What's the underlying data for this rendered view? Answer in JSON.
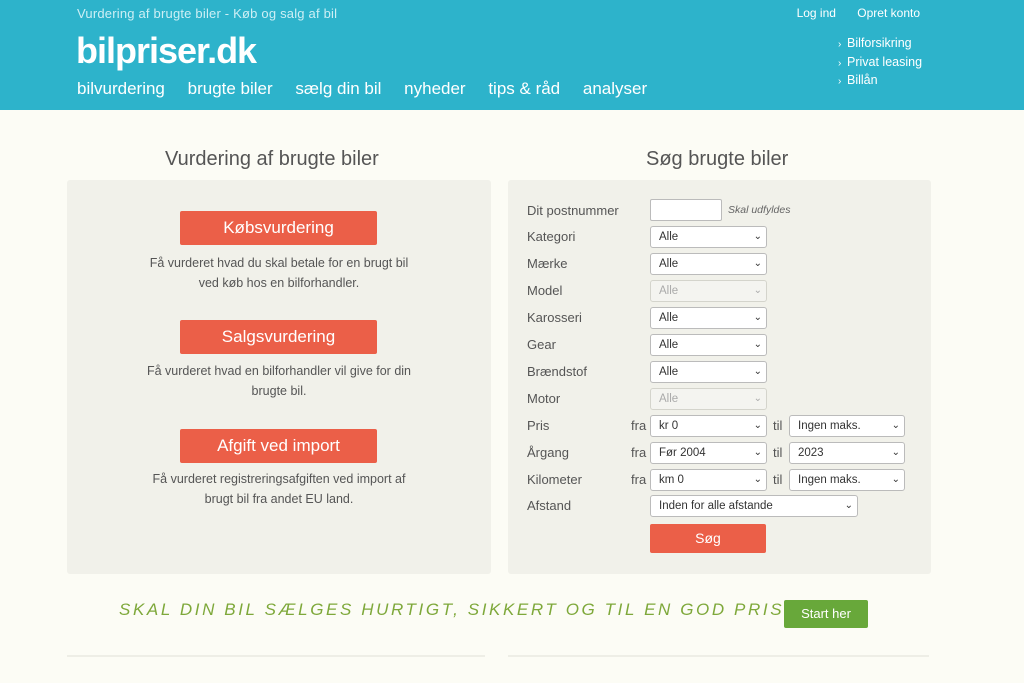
{
  "header": {
    "tagline": "Vurdering af brugte biler - Køb og salg af bil",
    "logo": "bilpriser.dk",
    "top_links": [
      "Log ind",
      "Opret konto"
    ],
    "side_links": [
      "Bilforsikring",
      "Privat leasing",
      "Billån"
    ],
    "nav": [
      "bilvurdering",
      "brugte biler",
      "sælg din bil",
      "nyheder",
      "tips & råd",
      "analyser"
    ]
  },
  "left": {
    "title": "Vurdering af brugte biler",
    "items": [
      {
        "button": "Købsvurdering",
        "desc1": "Få vurderet hvad du skal betale for en brugt bil",
        "desc2": "ved køb hos en bilforhandler."
      },
      {
        "button": "Salgsvurdering",
        "desc1": "Få vurderet hvad en bilforhandler vil give for din",
        "desc2": "brugte bil."
      },
      {
        "button": "Afgift ved import",
        "desc1": "Få vurderet registreringsafgiften ved import af",
        "desc2": "brugt bil fra andet EU land."
      }
    ]
  },
  "search": {
    "title": "Søg brugte biler",
    "postnummer_label": "Dit postnummer",
    "postnummer_value": "",
    "postnummer_hint": "Skal udfyldes",
    "kategori_label": "Kategori",
    "kategori_value": "Alle",
    "maerke_label": "Mærke",
    "maerke_value": "Alle",
    "model_label": "Model",
    "model_value": "Alle",
    "karosseri_label": "Karosseri",
    "karosseri_value": "Alle",
    "gear_label": "Gear",
    "gear_value": "Alle",
    "braendstof_label": "Brændstof",
    "braendstof_value": "Alle",
    "motor_label": "Motor",
    "motor_value": "Alle",
    "pris_label": "Pris",
    "pris_from": "kr 0",
    "pris_to": "Ingen maks.",
    "argang_label": "Årgang",
    "argang_from": "Før 2004",
    "argang_to": "2023",
    "km_label": "Kilometer",
    "km_from": "km 0",
    "km_to": "Ingen maks.",
    "afstand_label": "Afstand",
    "afstand_value": "Inden for alle afstande",
    "fra": "fra",
    "til": "til",
    "submit": "Søg"
  },
  "banner": {
    "text": "SKAL DIN BIL SÆLGES HURTIGT, SIKKERT OG TIL EN GOD PRIS?",
    "button": "Start her"
  },
  "colors": {
    "header": "#2db3cb",
    "accent": "#eb5f48",
    "green": "#68a83a"
  }
}
